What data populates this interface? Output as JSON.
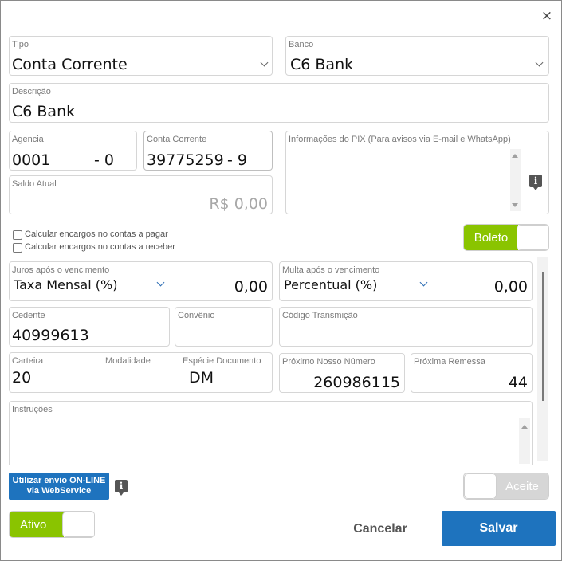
{
  "dialog": {
    "close_glyph": "×"
  },
  "tipo": {
    "label": "Tipo",
    "value": "Conta Corrente"
  },
  "banco": {
    "label": "Banco",
    "value": "C6 Bank"
  },
  "descricao": {
    "label": "Descrição",
    "value": "C6 Bank"
  },
  "agencia": {
    "label": "Agencia",
    "number": "0001",
    "digit": "- 0"
  },
  "conta": {
    "label": "Conta Corrente",
    "number": "39775259",
    "digit": "- 9"
  },
  "pix": {
    "label": "Informações do PIX (Para avisos via E-mail e WhatsApp)",
    "value": ""
  },
  "saldo": {
    "label": "Saldo Atual",
    "value": "R$ 0,00"
  },
  "checkboxes": [
    {
      "label": "Calcular encargos no contas a pagar",
      "checked": false
    },
    {
      "label": "Calcular encargos no contas a receber",
      "checked": false
    }
  ],
  "boleto_toggle": {
    "label": "Boleto",
    "on": true
  },
  "juros": {
    "label": "Juros após o vencimento",
    "type": "Taxa Mensal (%)",
    "value": "0,00"
  },
  "multa": {
    "label": "Multa após o vencimento",
    "type": "Percentual (%)",
    "value": "0,00"
  },
  "cedente": {
    "label": "Cedente",
    "value": "40999613"
  },
  "convenio": {
    "label": "Convênio",
    "value": ""
  },
  "codigo_transmissao": {
    "label": "Código Transmição",
    "value": ""
  },
  "carteira": {
    "label": "Carteira",
    "value": "20"
  },
  "modalidade": {
    "label": "Modalidade",
    "value": ""
  },
  "especie": {
    "label": "Espécie Documento",
    "value": "DM"
  },
  "proximo_nosso_numero": {
    "label": "Próximo Nosso Número",
    "value": "260986115"
  },
  "proxima_remessa": {
    "label": "Próxima Remessa",
    "value": "44"
  },
  "instrucoes": {
    "label": "Instruções",
    "value": ""
  },
  "online_button": {
    "line1": "Utilizar envio ON-LINE",
    "line2": "via WebService"
  },
  "aceite_toggle": {
    "label": "Aceite",
    "on": false
  },
  "ativo_toggle": {
    "label": "Ativo",
    "on": true
  },
  "footer": {
    "cancel_label": "Cancelar",
    "save_label": "Salvar"
  },
  "icons": {
    "info": "info-icon",
    "close": "close-icon",
    "chevron": "chevron-down-icon"
  },
  "colors": {
    "primary": "#1e73be",
    "toggle_on": "#8ac400",
    "toggle_off": "#d6d6d6"
  }
}
